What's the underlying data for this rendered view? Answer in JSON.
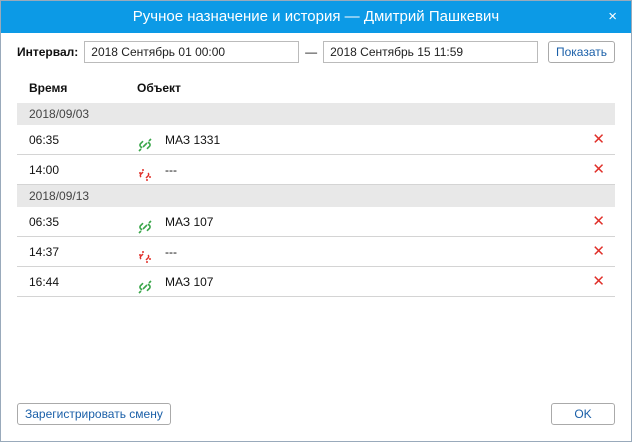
{
  "title": "Ручное назначение и история — Дмитрий Пашкевич",
  "close_icon": "×",
  "interval": {
    "label": "Интервал:",
    "from": "2018 Сентябрь 01 00:00",
    "separator": "—",
    "to": "2018 Сентябрь 15 11:59",
    "show_button": "Показать"
  },
  "columns": {
    "time": "Время",
    "object": "Объект"
  },
  "groups": [
    {
      "date": "2018/09/03",
      "rows": [
        {
          "time": "06:35",
          "icon": "link-icon",
          "object": "МАЗ 1331"
        },
        {
          "time": "14:00",
          "icon": "unlink-icon",
          "object": "---"
        }
      ]
    },
    {
      "date": "2018/09/13",
      "rows": [
        {
          "time": "06:35",
          "icon": "link-icon",
          "object": "МАЗ 107"
        },
        {
          "time": "14:37",
          "icon": "unlink-icon",
          "object": "---"
        },
        {
          "time": "16:44",
          "icon": "link-icon",
          "object": "МАЗ 107"
        }
      ]
    }
  ],
  "delete_icon": "✕",
  "register_button": "Зарегистрировать смену",
  "ok_button": "OK",
  "colors": {
    "title_bar": "#0c9ae6",
    "link": "#3aa64a",
    "unlink": "#e0302a"
  }
}
